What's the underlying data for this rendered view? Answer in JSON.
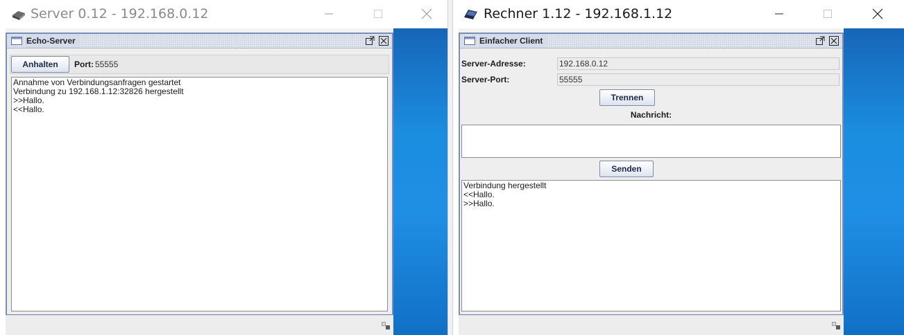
{
  "server_window": {
    "title": "Server 0.12 - 192.168.0.12",
    "frame": {
      "title": "Echo-Server",
      "stop_button": "Anhalten",
      "port_label": "Port:",
      "port_value": "55555",
      "log": [
        "Annahme von Verbindungsanfragen gestartet",
        "Verbindung zu 192.168.1.12:32826 hergestellt",
        ">>Hallo.",
        "<<Hallo."
      ]
    }
  },
  "client_window": {
    "title": "Rechner 1.12 - 192.168.1.12",
    "frame": {
      "title": "Einfacher Client",
      "server_address_label": "Server-Adresse:",
      "server_address_value": "192.168.0.12",
      "server_port_label": "Server-Port:",
      "server_port_value": "55555",
      "disconnect_button": "Trennen",
      "message_label": "Nachricht:",
      "message_value": "",
      "send_button": "Senden",
      "log": [
        "Verbindung hergestellt",
        "<<Hallo.",
        ">>Hallo."
      ]
    }
  },
  "icons": {
    "server_app": "server-icon",
    "client_app": "laptop-icon",
    "frame": "window-icon",
    "maximize": "maximize-icon",
    "close": "close-icon",
    "minimize": "minimize-icon",
    "detach": "detach-icon",
    "grip": "resize-grip-icon"
  },
  "colors": {
    "frame_border": "#7a8fb8",
    "desktop_blue": "#1f8fe4"
  }
}
